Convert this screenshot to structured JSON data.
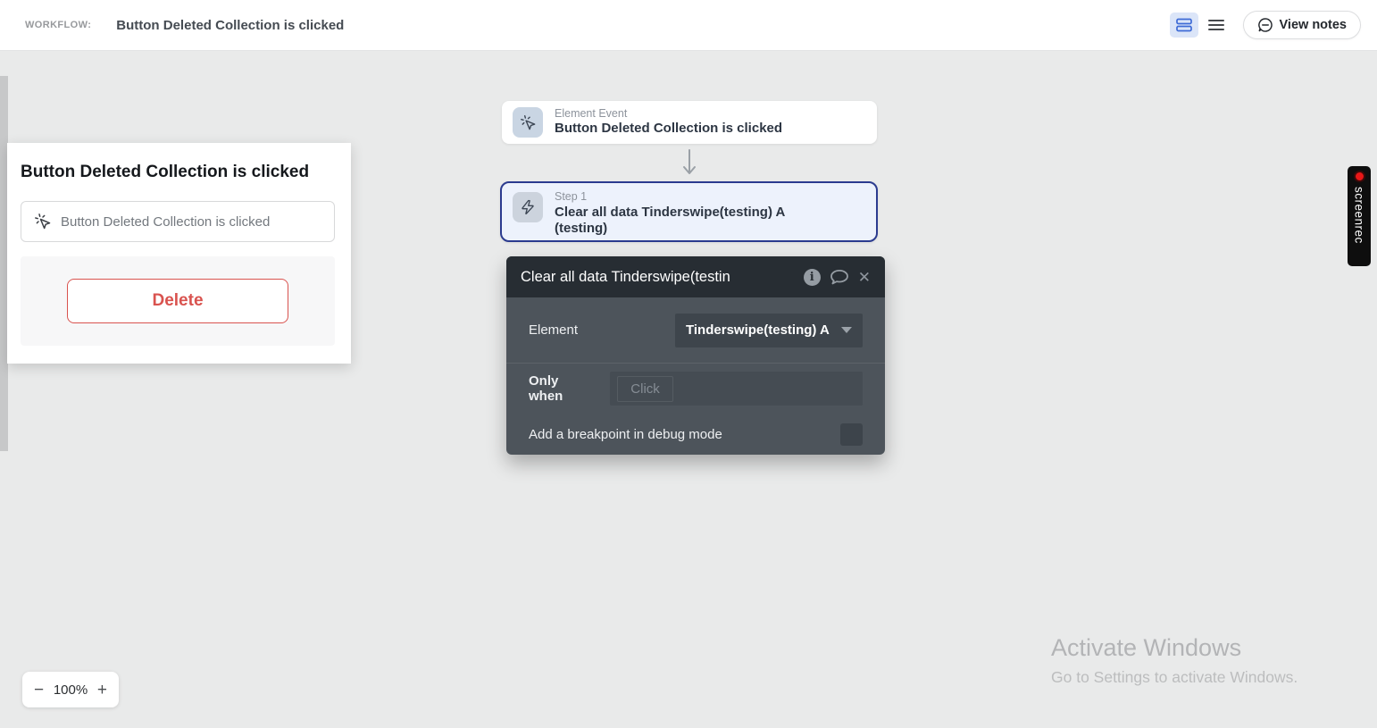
{
  "topbar": {
    "workflow_label": "WORKFLOW:",
    "workflow_title": "Button Deleted Collection is clicked",
    "view_notes_label": "View notes"
  },
  "left_panel": {
    "title": "Button Deleted Collection is clicked",
    "event_item_label": "Button Deleted Collection is clicked",
    "delete_label": "Delete"
  },
  "canvas": {
    "event_card": {
      "type_label": "Element Event",
      "title": "Button Deleted Collection is clicked"
    },
    "step_card": {
      "step_label": "Step 1",
      "title": "Clear all data Tinderswipe(testing) A (testing)"
    }
  },
  "popup": {
    "title": "Clear all data Tinderswipe(testin",
    "info_glyph": "i",
    "close_glyph": "✕",
    "element_label": "Element",
    "element_value": "Tinderswipe(testing) A",
    "only_when_label": "Only when",
    "only_when_placeholder": "Click",
    "breakpoint_label": "Add a breakpoint in debug mode",
    "breakpoint_checked": false
  },
  "zoom_control": {
    "minus_glyph": "−",
    "level": "100%",
    "plus_glyph": "+"
  },
  "watermarks": {
    "screenrec_label": "screenrec",
    "activate_title": "Activate Windows",
    "activate_subtitle": "Go to Settings to activate Windows."
  },
  "colors": {
    "accent_blue": "#3e6bd6",
    "selected_step_border": "#2b3b8f",
    "delete_red": "#d9534f",
    "record_red": "#e81717",
    "popup_body": "#4d545b",
    "popup_header": "#272d33",
    "canvas_bg": "#e9eaea"
  }
}
